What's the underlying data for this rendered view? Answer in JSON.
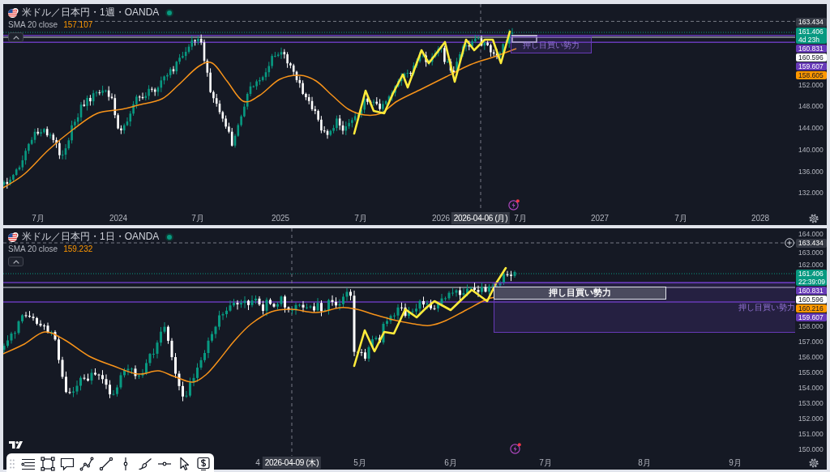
{
  "panels": [
    {
      "legend": {
        "symbol": "米ドル／日本円・1週・OANDA",
        "market_open": true,
        "indicator": "SMA 20 close",
        "indicator_value": "157.107"
      },
      "zones": [
        {
          "kind": "zone",
          "label": "押し目買い勢力"
        }
      ],
      "price_axis": {
        "ticks": [
          "152.000",
          "148.000",
          "144.000",
          "140.000",
          "136.000",
          "132.000"
        ],
        "tags": [
          {
            "price": "163.434",
            "color": "#363a45"
          },
          {
            "price": "161.406",
            "countdown": "4d 23h",
            "color": "#089981"
          },
          {
            "price": "160.831",
            "color": "#673ab7"
          },
          {
            "price": "160.596",
            "color": "#ffffff"
          },
          {
            "price": "159.607",
            "color": "#673ab7"
          },
          {
            "price": "158.605",
            "color": "#ff9800"
          }
        ]
      },
      "time_axis": {
        "labels": [
          "7月",
          "2024",
          "7月",
          "2025",
          "7月",
          "2026",
          "7月",
          "2027",
          "7月",
          "2028"
        ],
        "cursor_date": "2026-04-06 (月)"
      }
    },
    {
      "legend": {
        "symbol": "米ドル／日本円・1日・OANDA",
        "market_open": true,
        "indicator": "SMA 20 close",
        "indicator_value": "159.232"
      },
      "zones": [
        {
          "kind": "label_box",
          "label": "押し目買い勢力"
        },
        {
          "kind": "zone",
          "label": "押し目買い勢力"
        }
      ],
      "price_axis": {
        "ticks": [
          "164.000",
          "163.000",
          "162.000",
          "158.000",
          "157.000",
          "156.000",
          "155.000",
          "154.000",
          "153.000",
          "152.000",
          "151.000",
          "150.000"
        ],
        "tags": [
          {
            "price": "163.434",
            "color": "#363a45",
            "plus_button": true
          },
          {
            "price": "161.406",
            "countdown": "22:39:09",
            "color": "#089981"
          },
          {
            "price": "160.831",
            "color": "#673ab7"
          },
          {
            "price": "160.596",
            "color": "#ffffff"
          },
          {
            "price": "160.216",
            "color": "#ff9800"
          },
          {
            "price": "159.607",
            "color": "#673ab7"
          }
        ]
      },
      "time_axis": {
        "labels": [
          "4",
          "5月",
          "6月",
          "7月",
          "8月",
          "9月"
        ],
        "cursor_date": "2026-04-09 (木)"
      }
    }
  ]
}
